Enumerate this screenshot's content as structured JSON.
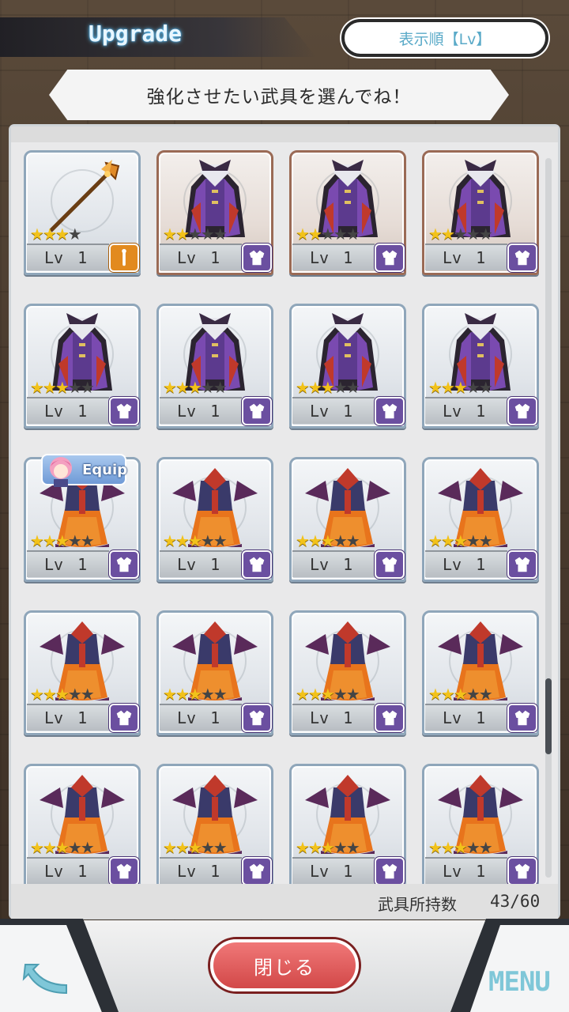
{
  "header": {
    "title": "Upgrade",
    "sort_label": "表示順【Lv】"
  },
  "instruction": "強化させたい武具を選んでね！",
  "equip_label": "Equip",
  "items": [
    {
      "kind": "weapon",
      "stars": 3,
      "max_stars": 4,
      "level_label": "Lv",
      "level": "1",
      "frame": "silver"
    },
    {
      "kind": "vampire",
      "stars": 2,
      "max_stars": 5,
      "level_label": "Lv",
      "level": "1",
      "frame": "copper"
    },
    {
      "kind": "vampire",
      "stars": 2,
      "max_stars": 5,
      "level_label": "Lv",
      "level": "1",
      "frame": "copper"
    },
    {
      "kind": "vampire",
      "stars": 2,
      "max_stars": 5,
      "level_label": "Lv",
      "level": "1",
      "frame": "copper"
    },
    {
      "kind": "vampire",
      "stars": 3,
      "max_stars": 5,
      "level_label": "Lv",
      "level": "1",
      "frame": "silver"
    },
    {
      "kind": "vampire",
      "stars": 3,
      "max_stars": 5,
      "level_label": "Lv",
      "level": "1",
      "frame": "silver"
    },
    {
      "kind": "vampire",
      "stars": 3,
      "max_stars": 5,
      "level_label": "Lv",
      "level": "1",
      "frame": "silver"
    },
    {
      "kind": "vampire",
      "stars": 3,
      "max_stars": 5,
      "level_label": "Lv",
      "level": "1",
      "frame": "silver"
    },
    {
      "kind": "dress",
      "stars": 3,
      "max_stars": 5,
      "level_label": "Lv",
      "level": "1",
      "frame": "silver",
      "equipped": true
    },
    {
      "kind": "dress",
      "stars": 3,
      "max_stars": 5,
      "level_label": "Lv",
      "level": "1",
      "frame": "silver"
    },
    {
      "kind": "dress",
      "stars": 3,
      "max_stars": 5,
      "level_label": "Lv",
      "level": "1",
      "frame": "silver"
    },
    {
      "kind": "dress",
      "stars": 3,
      "max_stars": 5,
      "level_label": "Lv",
      "level": "1",
      "frame": "silver"
    },
    {
      "kind": "dress",
      "stars": 3,
      "max_stars": 5,
      "level_label": "Lv",
      "level": "1",
      "frame": "silver"
    },
    {
      "kind": "dress",
      "stars": 3,
      "max_stars": 5,
      "level_label": "Lv",
      "level": "1",
      "frame": "silver"
    },
    {
      "kind": "dress",
      "stars": 3,
      "max_stars": 5,
      "level_label": "Lv",
      "level": "1",
      "frame": "silver"
    },
    {
      "kind": "dress",
      "stars": 3,
      "max_stars": 5,
      "level_label": "Lv",
      "level": "1",
      "frame": "silver"
    },
    {
      "kind": "dress",
      "stars": 3,
      "max_stars": 5,
      "level_label": "Lv",
      "level": "1",
      "frame": "silver"
    },
    {
      "kind": "dress",
      "stars": 3,
      "max_stars": 5,
      "level_label": "Lv",
      "level": "1",
      "frame": "silver"
    },
    {
      "kind": "dress",
      "stars": 3,
      "max_stars": 5,
      "level_label": "Lv",
      "level": "1",
      "frame": "silver"
    },
    {
      "kind": "dress",
      "stars": 3,
      "max_stars": 5,
      "level_label": "Lv",
      "level": "1",
      "frame": "silver"
    }
  ],
  "footer": {
    "count_label": "武具所持数",
    "count_value": "43/60",
    "close_label": "閉じる",
    "menu_label": "MENU"
  },
  "colors": {
    "accent_cyan": "#6fd0ff",
    "close_red": "#d24848",
    "armor_purple": "#6b4fa0",
    "weapon_orange": "#e28a1e",
    "star_gold": "#f2c21a"
  }
}
